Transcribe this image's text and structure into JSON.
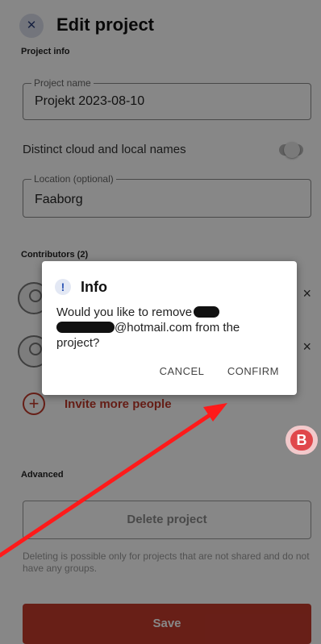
{
  "header": {
    "title": "Edit project",
    "close_icon": "close-icon"
  },
  "project_info": {
    "section_label": "Project info",
    "name_legend": "Project name",
    "name_value": "Projekt 2023-08-10",
    "toggle_label": "Distinct cloud and local names",
    "toggle_on": false,
    "location_legend": "Location (optional)",
    "location_value": "Faaborg"
  },
  "contributors": {
    "section_label": "Contributors (2)",
    "remove_symbol": "×",
    "invite_symbol": "+",
    "invite_label": "Invite more people"
  },
  "advanced": {
    "section_label": "Advanced",
    "delete_label": "Delete project",
    "delete_note": "Deleting is possible only for projects that are not shared and do not have any groups."
  },
  "save_label": "Save",
  "dialog": {
    "icon_symbol": "!",
    "title": "Info",
    "body_start": "Would you like to remove",
    "body_email_domain": "@hotmail.com from the",
    "body_end": "project?",
    "cancel_label": "CANCEL",
    "confirm_label": "CONFIRM"
  },
  "badge": {
    "label": "B"
  },
  "colors": {
    "accent": "#c43b2d",
    "annotation_arrow": "#ff1a1a",
    "scrim": "rgba(0,0,0,0.47)"
  }
}
